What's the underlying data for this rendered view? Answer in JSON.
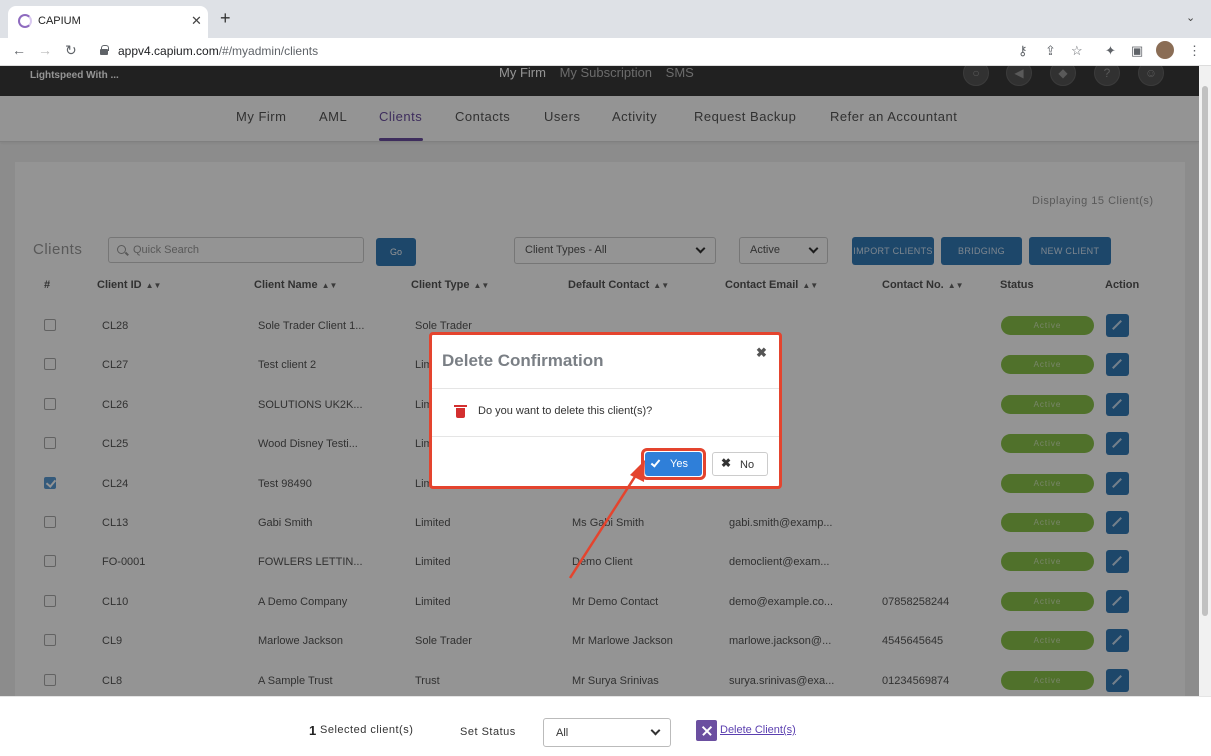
{
  "browser": {
    "tab_title": "CAPIUM",
    "url_domain": "appv4.capium.com",
    "url_path": "/#/myadmin/clients"
  },
  "topbar": {
    "org_name": "Lightspeed With ...",
    "links": [
      "My Firm",
      "My Subscription",
      "SMS"
    ]
  },
  "subnav": {
    "items": [
      "My Firm",
      "AML",
      "Clients",
      "Contacts",
      "Users",
      "Activity",
      "Request Backup",
      "Refer an Accountant"
    ],
    "active": "Clients"
  },
  "clients": {
    "heading": "Clients",
    "displaying": "Displaying 15 Client(s)",
    "search_placeholder": "Quick Search",
    "go_label": "Go",
    "client_type_filter": "Client Types - All",
    "status_filter": "Active",
    "import_label": "IMPORT CLIENTS",
    "bridging_label": "BRIDGING",
    "new_client_label": "NEW CLIENT",
    "columns": [
      "#",
      "Client ID",
      "Client Name",
      "Client Type",
      "Default Contact",
      "Contact Email",
      "Contact No.",
      "Status",
      "Action"
    ],
    "rows": [
      {
        "id": "CL28",
        "name": "Sole Trader Client 1...",
        "type": "Sole Trader",
        "contact": "",
        "email": "",
        "phone": "",
        "status": "Active",
        "checked": false
      },
      {
        "id": "CL27",
        "name": "Test client 2",
        "type": "Lim",
        "contact": "",
        "email": "",
        "phone": "",
        "status": "Active",
        "checked": false
      },
      {
        "id": "CL26",
        "name": "SOLUTIONS UK2K...",
        "type": "Lim",
        "contact": "",
        "email": "",
        "phone": "",
        "status": "Active",
        "checked": false
      },
      {
        "id": "CL25",
        "name": "Wood Disney Testi...",
        "type": "Lim",
        "contact": "",
        "email": "",
        "phone": "",
        "status": "Active",
        "checked": false
      },
      {
        "id": "CL24",
        "name": "Test 98490",
        "type": "Lim",
        "contact": "",
        "email": "",
        "phone": "",
        "status": "Active",
        "checked": true
      },
      {
        "id": "CL13",
        "name": "Gabi Smith",
        "type": "Limited",
        "contact": "Ms Gabi Smith",
        "email": "gabi.smith@examp...",
        "phone": "",
        "status": "Active",
        "checked": false
      },
      {
        "id": "FO-0001",
        "name": "FOWLERS LETTIN...",
        "type": "Limited",
        "contact": "Demo Client",
        "email": "democlient@exam...",
        "phone": "",
        "status": "Active",
        "checked": false
      },
      {
        "id": "CL10",
        "name": "A Demo Company",
        "type": "Limited",
        "contact": "Mr Demo Contact",
        "email": "demo@example.co...",
        "phone": "07858258244",
        "status": "Active",
        "checked": false
      },
      {
        "id": "CL9",
        "name": "Marlowe Jackson",
        "type": "Sole Trader",
        "contact": "Mr Marlowe Jackson",
        "email": "marlowe.jackson@...",
        "phone": "4545645645",
        "status": "Active",
        "checked": false
      },
      {
        "id": "CL8",
        "name": "A Sample Trust",
        "type": "Trust",
        "contact": "Mr Surya Srinivas",
        "email": "surya.srinivas@exa...",
        "phone": "01234569874",
        "status": "Active",
        "checked": false
      }
    ]
  },
  "modal": {
    "title": "Delete Confirmation",
    "message": "Do you want to delete this client(s)?",
    "yes_label": "Yes",
    "no_label": "No"
  },
  "bottom_bar": {
    "selected_count": "1",
    "selected_label": "Selected client(s)",
    "set_status_label": "Set Status",
    "status_value": "All",
    "delete_label": "Delete Client(s)"
  },
  "colors": {
    "accent_purple": "#6b4fa0",
    "primary_blue": "#337ab7",
    "active_green": "#8bc34a",
    "highlight_red": "#e4442e"
  }
}
